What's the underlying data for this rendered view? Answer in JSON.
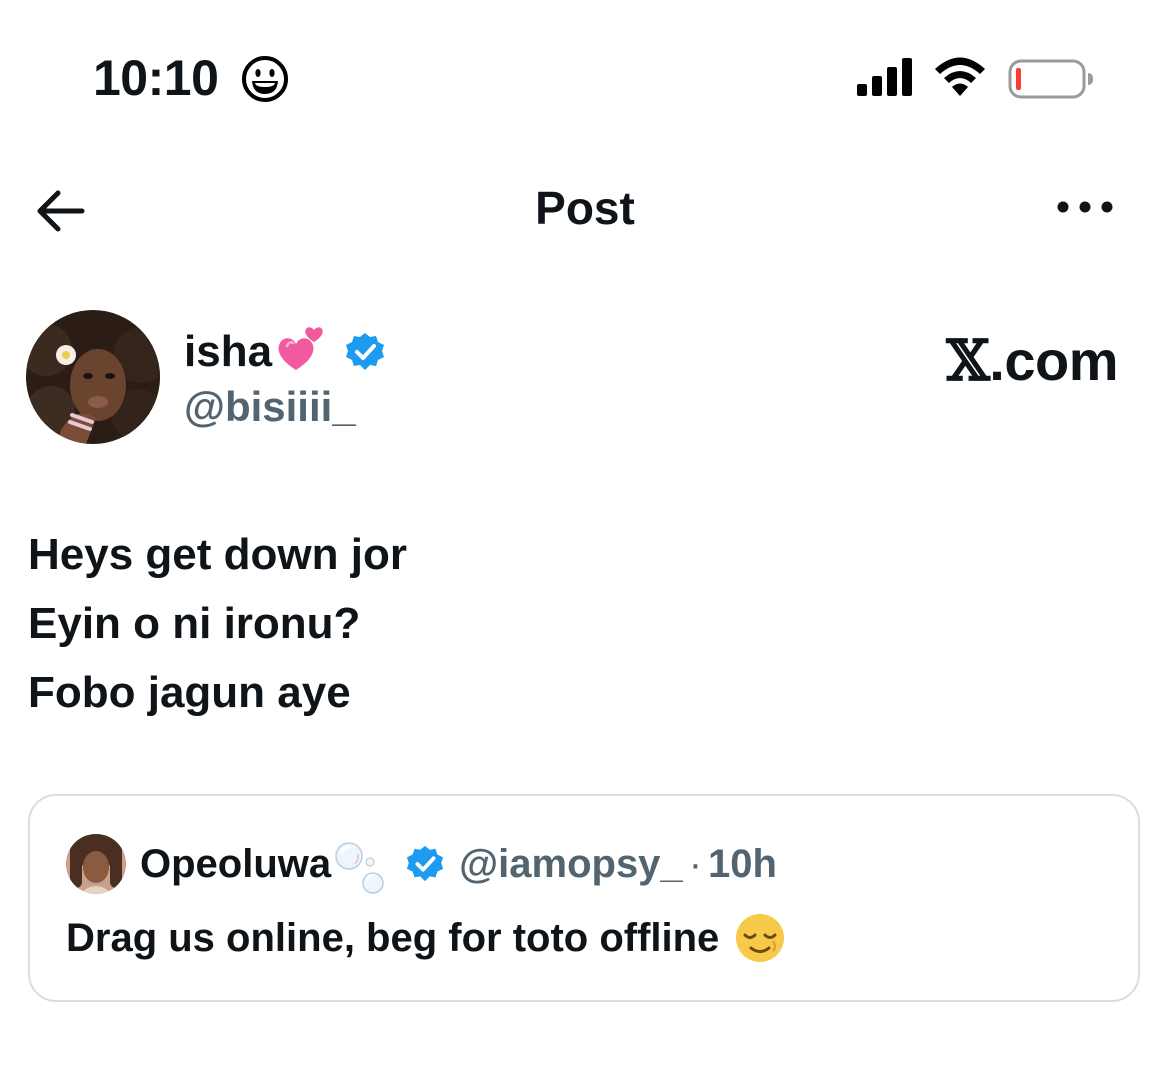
{
  "status_bar": {
    "time": "10:10",
    "status_emoji": "grinning-face-emoji",
    "signal": "cellular-signal-icon",
    "wifi": "wifi-icon",
    "battery": "battery-low-icon",
    "battery_color": "#ff3b30"
  },
  "nav": {
    "title": "Post",
    "back_icon": "back-arrow-icon",
    "more_icon": "more-options-icon"
  },
  "post": {
    "display_name": "isha",
    "name_emoji": "two-hearts-emoji",
    "verified": true,
    "handle": "@bisiiii_",
    "watermark": ".com",
    "watermark_logo": "𝕏",
    "lines": [
      "Heys get down jor",
      "Eyin o ni ironu?",
      "Fobo jagun aye"
    ]
  },
  "quoted_post": {
    "display_name": "Opeoluwa",
    "name_emoji": "bubbles-emoji",
    "verified": true,
    "handle": "@iamopsy_",
    "separator": "·",
    "time": "10h",
    "text": "Drag us online, beg for toto offline",
    "text_emoji": "relieved-face-emoji"
  },
  "colors": {
    "text_primary": "#0f1419",
    "text_secondary": "#536471",
    "verified_blue": "#1d9bf0",
    "border": "#d9dde1"
  }
}
